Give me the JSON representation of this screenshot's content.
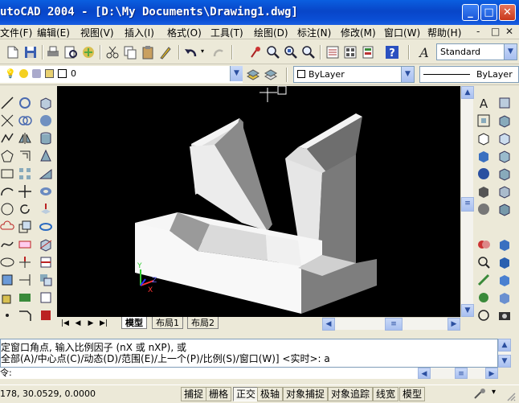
{
  "window": {
    "title": "utoCAD 2004 - [D:\\My Documents\\Drawing1.dwg]",
    "minimize": "_",
    "maximize": "□",
    "close": "✕"
  },
  "menu": {
    "items": [
      "文件(F)",
      "编辑(E)",
      "视图(V)",
      "插入(I)",
      "格式(O)",
      "工具(T)",
      "绘图(D)",
      "标注(N)",
      "修改(M)",
      "窗口(W)",
      "帮助(H)"
    ],
    "doc_controls": [
      "-",
      "□",
      "✕"
    ]
  },
  "toolbar": {
    "text_style": "Standard"
  },
  "layers": {
    "layer_name": "0",
    "color": "ByLayer",
    "linetype": "ByLayer"
  },
  "tabs": {
    "model": "模型",
    "layout1": "布局1",
    "layout2": "布局2",
    "nav": [
      "|◀",
      "◀",
      "▶",
      "▶|"
    ]
  },
  "command": {
    "line1": "定窗口角点, 输入比例因子 (nX 或 nXP), 或",
    "line2": "全部(A)/中心点(C)/动态(D)/范围(E)/上一个(P)/比例(S)/窗口(W)] <实时>: a",
    "prompt": "令:"
  },
  "status": {
    "coords": "178, 30.0529, 0.0000",
    "toggles": [
      {
        "label": "捕捉",
        "on": false
      },
      {
        "label": "栅格",
        "on": false
      },
      {
        "label": "正交",
        "on": true
      },
      {
        "label": "极轴",
        "on": false
      },
      {
        "label": "对象捕捉",
        "on": false
      },
      {
        "label": "对象追踪",
        "on": false
      },
      {
        "label": "线宽",
        "on": false
      },
      {
        "label": "模型",
        "on": false
      }
    ]
  },
  "ucs": {
    "x": "X",
    "y": "Y",
    "z": "Z"
  },
  "colors": {
    "title_bar": "#0845c8",
    "canvas": "#000000",
    "face_light": "#f0f0f0",
    "face_mid": "#c8c8c8",
    "face_dark": "#7a7a7a"
  }
}
